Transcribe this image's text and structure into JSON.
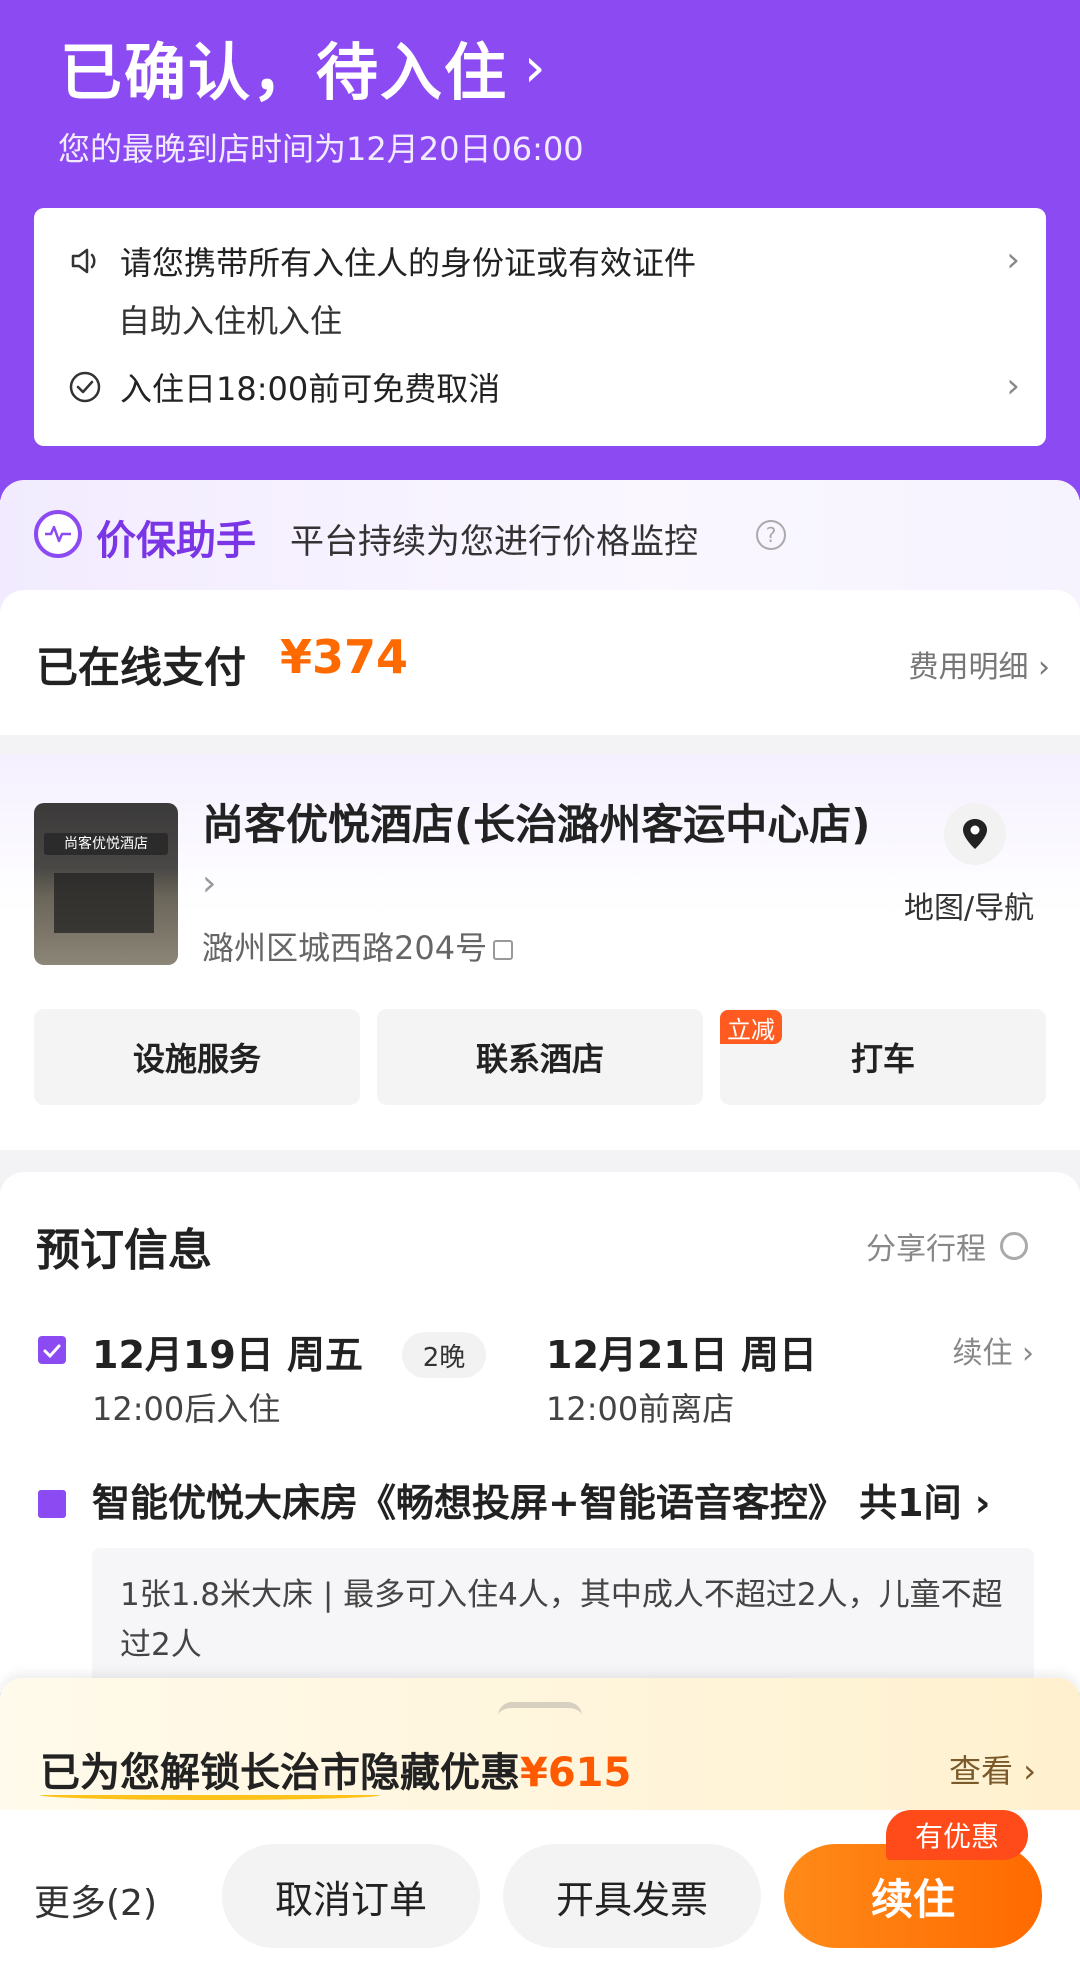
{
  "header": {
    "title": "已确认，待入住",
    "title_chevron": "›",
    "subtitle": "您的最晚到店时间为12月20日06:00",
    "bg_color": "#8c4bf2"
  },
  "notice": {
    "line1": "请您携带所有入住人的身份证或有效证件",
    "line2": "自助入住机入住",
    "line3": "入住日18:00前可免费取消",
    "chevron": "›"
  },
  "price_guard": {
    "title": "价保助手",
    "subtitle": "平台持续为您进行价格监控",
    "help": "?"
  },
  "payment": {
    "label": "已在线支付",
    "amount": "¥374",
    "detail_link": "费用明细 ›",
    "accent": "#ff6a00"
  },
  "hotel": {
    "name": "尚客优悦酒店(长治潞州客运中心店)",
    "name_chevron": "›",
    "address": "潞州区城西路204号",
    "map_label": "地图/导航",
    "photo_sign": "尚客优悦酒店",
    "actions": [
      "设施服务",
      "联系酒店",
      "打车"
    ],
    "taxi_badge": "立减"
  },
  "booking": {
    "title": "预订信息",
    "share": "分享行程",
    "checkin_date": "12月19日 周五",
    "checkin_time": "12:00后入住",
    "nights": "2晚",
    "checkout_date": "12月21日 周日",
    "checkout_time": "12:00前离店",
    "extend": "续住 ›",
    "room_name": "智能优悦大床房《畅想投屏+智能语音客控》 共1间 ›",
    "room_detail": "1张1.8米大床 | 最多可入住4人，其中成人不超过2人，儿童不超过2人"
  },
  "promo": {
    "text": "已为您解锁长治市隐藏优惠",
    "amount": "¥615",
    "view": "查看 ›"
  },
  "bottom_bar": {
    "more": "更多(2)",
    "cancel": "取消订单",
    "invoice": "开具发票",
    "extend": "续住",
    "badge": "有优惠"
  }
}
